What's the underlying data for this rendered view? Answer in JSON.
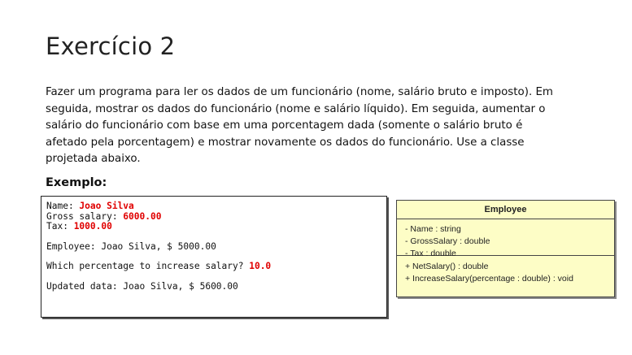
{
  "title": "Exercício 2",
  "description": [
    "Fazer um programa para ler os dados de um funcionário (nome, salário bruto e imposto). Em",
    "seguida, mostrar os dados do funcionário (nome e salário líquido). Em seguida, aumentar o",
    "salário do funcionário com base em uma porcentagem dada (somente o salário bruto é",
    "afetado pela porcentagem) e mostrar novamente os dados do funcionário. Use a classe",
    "projetada abaixo."
  ],
  "example_heading": "Exemplo:",
  "console": {
    "name_prompt": "Name: ",
    "name_value": "Joao Silva",
    "gross_prompt": "Gross salary: ",
    "gross_value": "6000.00",
    "tax_prompt": "Tax: ",
    "tax_value": "1000.00",
    "employee_line": "Employee: Joao Silva, $ 5000.00",
    "percentage_prompt": "Which percentage to increase salary? ",
    "percentage_value": "10.0",
    "updated_line": "Updated data: Joao Silva, $ 5600.00"
  },
  "uml": {
    "class_name": "Employee",
    "attributes": [
      "- Name : string",
      "- GrossSalary : double",
      "- Tax : double"
    ],
    "operations": [
      "+ NetSalary() : double",
      "+ IncreaseSalary(percentage : double) : void"
    ],
    "fill_color": "#fdfdc6"
  }
}
